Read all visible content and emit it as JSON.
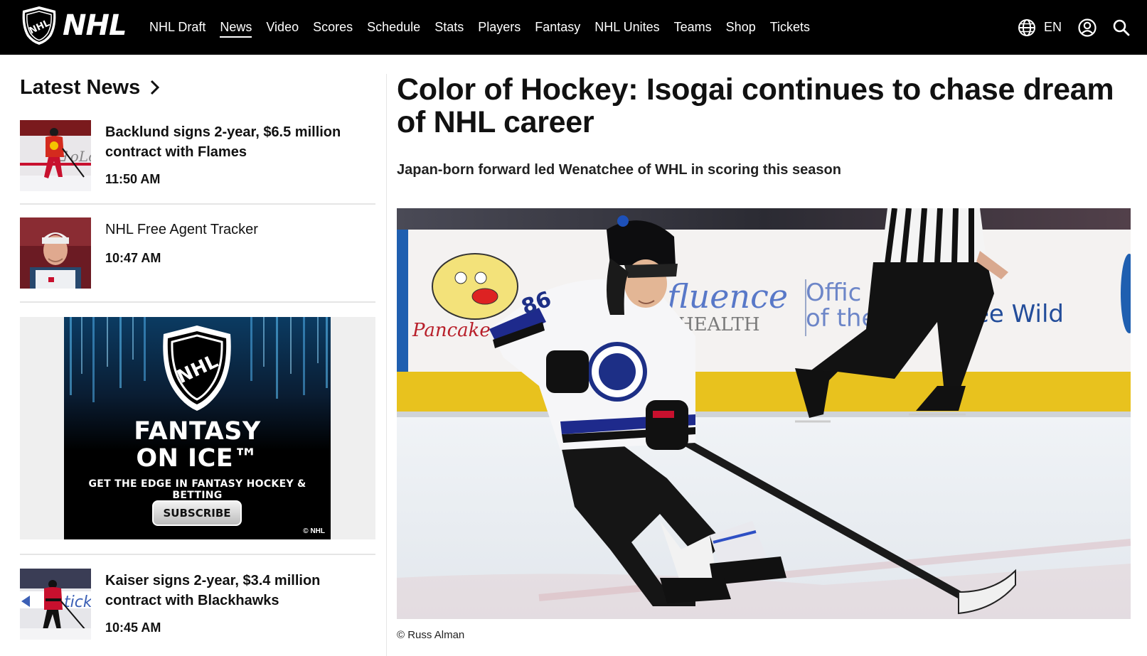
{
  "brand": {
    "name": "NHL"
  },
  "nav": {
    "items": [
      {
        "label": "NHL Draft",
        "active": false
      },
      {
        "label": "News",
        "active": true
      },
      {
        "label": "Video",
        "active": false
      },
      {
        "label": "Scores",
        "active": false
      },
      {
        "label": "Schedule",
        "active": false
      },
      {
        "label": "Stats",
        "active": false
      },
      {
        "label": "Players",
        "active": false
      },
      {
        "label": "Fantasy",
        "active": false
      },
      {
        "label": "NHL Unites",
        "active": false
      },
      {
        "label": "Teams",
        "active": false
      },
      {
        "label": "Shop",
        "active": false
      },
      {
        "label": "Tickets",
        "active": false
      }
    ],
    "language": "EN",
    "icons": [
      "globe-icon",
      "account-icon",
      "search-icon"
    ]
  },
  "sidebar": {
    "heading": "Latest News",
    "stories": [
      {
        "title": "Backlund signs 2-year, $6.5 million contract with Flames",
        "time": "11:50 AM"
      },
      {
        "title": "NHL Free Agent Tracker",
        "time": "10:47 AM"
      },
      {
        "title": "Kaiser signs 2-year, $3.4 million contract with Blackhawks",
        "time": "10:45 AM"
      }
    ],
    "ad": {
      "brand_text": "NHL",
      "title_line1": "FANTASY",
      "title_line2": "ON ICE™",
      "tagline": "GET THE EDGE IN FANTASY HOCKEY & BETTING",
      "button": "SUBSCRIBE",
      "copyright": "© NHL"
    }
  },
  "article": {
    "headline": "Color of Hockey: Isogai continues to chase dream of NHL career",
    "subhead": "Japan-born forward led Wenatchee of WHL in scoring this season",
    "photo_credit": "© Russ Alman"
  },
  "colors": {
    "nav_bg": "#000000",
    "text": "#111111",
    "divider": "#e5e5e5",
    "ad_bg": "#efefef"
  }
}
